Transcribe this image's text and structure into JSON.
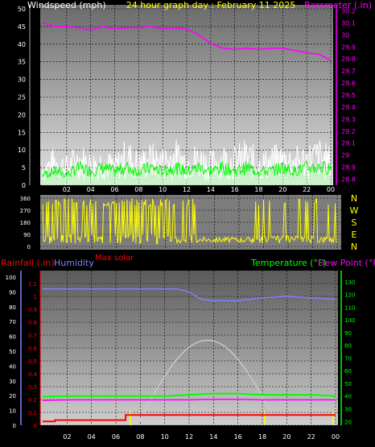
{
  "chart_data": [
    {
      "type": "line",
      "title": "24 hour graph day : February 11 2025",
      "left_axis_label": "Windspeed (mph)",
      "right_axis_label": "Barometer (.in)",
      "x_ticks": [
        "02",
        "04",
        "06",
        "08",
        "10",
        "12",
        "14",
        "16",
        "18",
        "20",
        "22",
        "00"
      ],
      "left_ticks": [
        "0",
        "5",
        "10",
        "15",
        "20",
        "25",
        "30",
        "35",
        "40",
        "45",
        "50"
      ],
      "left_range": [
        0,
        50
      ],
      "right_ticks": [
        "28.8",
        "28.9",
        "29",
        "29.1",
        "29.2",
        "29.3",
        "29.4",
        "29.5",
        "29.6",
        "29.7",
        "29.8",
        "29.9",
        "30",
        "30.1",
        "30.2"
      ],
      "right_range": [
        28.75,
        30.25
      ],
      "series": [
        {
          "key": "gust",
          "color": "#ffffff",
          "x": [
            0,
            1,
            2,
            3,
            4,
            5,
            6,
            7,
            8,
            9,
            10,
            11,
            12,
            13,
            14,
            15,
            16,
            17,
            18,
            19,
            20,
            21,
            22,
            23,
            24
          ],
          "values": [
            6,
            9,
            7,
            10,
            8,
            9,
            7,
            11,
            8,
            10,
            9,
            11,
            9,
            10,
            8,
            10,
            9,
            11,
            8,
            9,
            10,
            9,
            10,
            11,
            9
          ]
        },
        {
          "key": "wind_avg",
          "color": "#00ff00",
          "x": [
            0,
            1,
            2,
            3,
            4,
            5,
            6,
            7,
            8,
            9,
            10,
            11,
            12,
            13,
            14,
            15,
            16,
            17,
            18,
            19,
            20,
            21,
            22,
            23,
            24
          ],
          "values": [
            3,
            4,
            3,
            5,
            4,
            5,
            4,
            5,
            4,
            5,
            4,
            5,
            4,
            5,
            4,
            5,
            4,
            5,
            4,
            4,
            5,
            4,
            5,
            5,
            5
          ]
        },
        {
          "key": "barometer",
          "color": "#ff00ff",
          "x": [
            0,
            1,
            2,
            3,
            4,
            5,
            6,
            7,
            8,
            9,
            10,
            11,
            12,
            13,
            14,
            15,
            16,
            17,
            18,
            19,
            20,
            21,
            22,
            23,
            24
          ],
          "values": [
            30.1,
            30.07,
            30.07,
            30.06,
            30.04,
            30.07,
            30.05,
            30.06,
            30.06,
            30.07,
            30.05,
            30.06,
            30.05,
            30.0,
            29.93,
            29.89,
            29.88,
            29.89,
            29.88,
            29.89,
            29.89,
            29.87,
            29.85,
            29.84,
            29.79
          ]
        }
      ]
    },
    {
      "type": "scatter",
      "right_labels": [
        "N",
        "W",
        "S",
        "E",
        "N"
      ],
      "left_ticks": [
        "0",
        "90",
        "180",
        "270",
        "360"
      ],
      "left_range": [
        0,
        360
      ],
      "x_ticks": [
        "02",
        "04",
        "06",
        "08",
        "10",
        "12",
        "14",
        "16",
        "18",
        "20",
        "22",
        "00"
      ],
      "series": [
        {
          "key": "direction",
          "color": "#ffff00",
          "x": [
            0,
            1,
            2,
            3,
            4,
            5,
            6,
            7,
            8,
            9,
            10,
            11,
            12,
            13,
            14,
            15,
            16,
            17,
            18,
            19,
            20,
            21,
            22,
            23,
            24
          ],
          "values": [
            340,
            200,
            20,
            330,
            60,
            310,
            40,
            320,
            50,
            300,
            30,
            310,
            70,
            45,
            40,
            60,
            300,
            50,
            40,
            330,
            45,
            50,
            40,
            45,
            60
          ]
        }
      ]
    },
    {
      "type": "line",
      "label_rainfall": "Rainfall (.in)",
      "label_humidity": "Humidity",
      "label_temperature": "Temperature (°F)",
      "label_dewpoint": "Dew Point (°F)",
      "label_solar": "Max solar",
      "x_ticks": [
        "02",
        "04",
        "06",
        "08",
        "10",
        "12",
        "14",
        "16",
        "18",
        "20",
        "22",
        "00"
      ],
      "humidity_ticks": [
        "0",
        "10",
        "20",
        "30",
        "40",
        "50",
        "60",
        "70",
        "80",
        "90",
        "100"
      ],
      "humidity_range": [
        0,
        100
      ],
      "rain_ticks": [
        "0",
        "0.1",
        "0.2",
        "0.3",
        "0.4",
        "0.5",
        "0.6",
        "0.7",
        "0.8",
        "0.9",
        "1",
        "1.1"
      ],
      "rain_range": [
        0,
        1.15
      ],
      "temp_ticks": [
        "20",
        "30",
        "40",
        "50",
        "60",
        "70",
        "80",
        "90",
        "100",
        "110",
        "120",
        "130"
      ],
      "temp_range": [
        17,
        135
      ],
      "series": [
        {
          "key": "humidity",
          "color": "#8080ff",
          "x": [
            0,
            2,
            4,
            6,
            8,
            10,
            11,
            12,
            13,
            14,
            16,
            18,
            20,
            22,
            24
          ],
          "values": [
            92,
            92,
            92,
            92,
            92,
            92,
            92,
            90,
            85,
            84,
            84,
            86,
            87,
            86,
            85
          ]
        },
        {
          "key": "temperature",
          "color": "#00ff00",
          "x": [
            0,
            2,
            4,
            6,
            8,
            10,
            12,
            14,
            16,
            18,
            20,
            22,
            24
          ],
          "values": [
            39.5,
            40,
            40,
            40,
            40,
            40,
            41,
            42,
            42,
            41,
            41,
            41,
            40
          ]
        },
        {
          "key": "dew_point",
          "color": "#ff00ff",
          "x": [
            0,
            2,
            4,
            6,
            8,
            10,
            12,
            14,
            16,
            18,
            20,
            22,
            24
          ],
          "values": [
            36.5,
            37,
            37,
            37,
            37,
            37,
            37,
            37.5,
            37.5,
            37,
            37,
            37,
            37
          ]
        },
        {
          "key": "rainfall",
          "color": "#ff0000",
          "x": [
            0,
            1,
            2,
            4,
            6,
            6.8,
            8,
            10,
            12,
            14,
            16,
            18,
            20,
            22,
            24
          ],
          "values": [
            0.03,
            0.04,
            0.04,
            0.04,
            0.04,
            0.08,
            0.08,
            0.08,
            0.08,
            0.08,
            0.08,
            0.08,
            0.08,
            0.08,
            0.08
          ]
        },
        {
          "key": "max_solar",
          "color": "#c8c8c8",
          "x": [
            7.8,
            9,
            10,
            11,
            12,
            13,
            14,
            15,
            16,
            17,
            18,
            19.2
          ],
          "values": [
            18,
            25,
            38,
            55,
            71,
            81,
            84,
            81,
            71,
            55,
            38,
            18
          ]
        },
        {
          "key": "solar_bars",
          "color": "#ffff00",
          "x": [
            7.2,
            18.2,
            23.8
          ],
          "values": [
            28,
            28,
            28
          ]
        }
      ]
    }
  ]
}
